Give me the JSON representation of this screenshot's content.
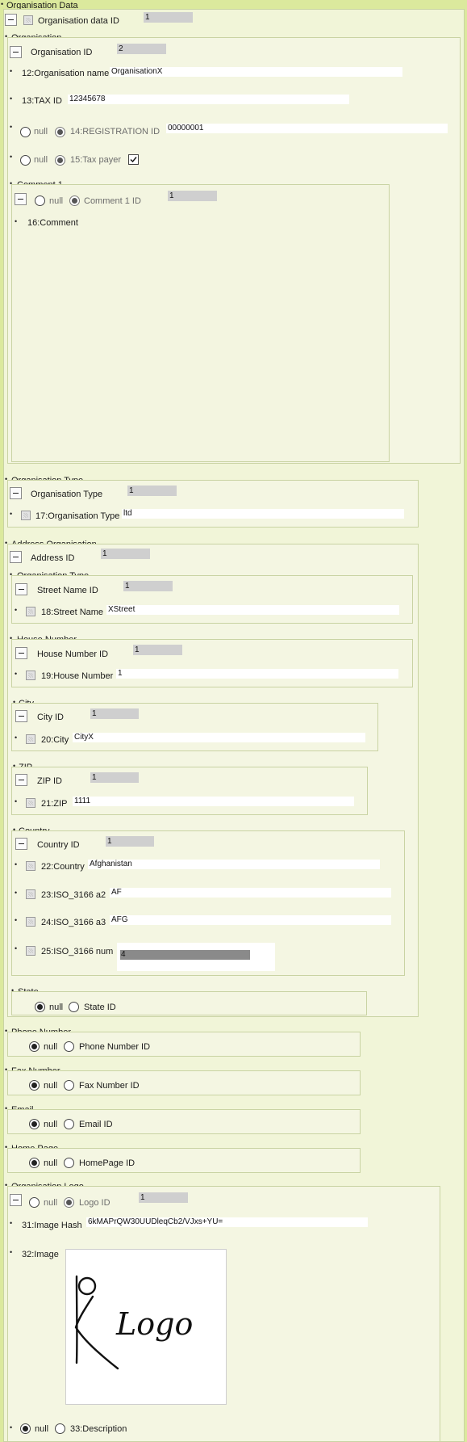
{
  "root": {
    "legend": "Organisation Data",
    "id_label": "Organisation data ID",
    "id_value": "1"
  },
  "organisation": {
    "legend": "Organisation",
    "id_label": "Organisation ID",
    "id_value": "2",
    "name_label": "12:Organisation name",
    "name_value": "OrganisationX",
    "tax_label": "13:TAX ID",
    "tax_value": "12345678",
    "null_label": "null",
    "reg_label": "14:REGISTRATION ID",
    "reg_value": "00000001",
    "taxpayer_label": "15:Tax payer",
    "taxpayer_checked": true
  },
  "comment": {
    "legend": "Comment 1",
    "null_label": "null",
    "id_label": "Comment 1 ID",
    "id_value": "1",
    "comment_label": "16:Comment"
  },
  "org_type": {
    "legend": "Organisation Type",
    "id_label": "Organisation Type",
    "id_value": "1",
    "type_label": "17:Organisation Type",
    "type_value": "ltd"
  },
  "address": {
    "legend": "Address Organisation",
    "id_label": "Address ID",
    "id_value": "1",
    "street": {
      "legend": "Organisation Type",
      "id_label": "Street Name ID",
      "id_value": "1",
      "name_label": "18:Street Name",
      "name_value": "XStreet"
    },
    "house": {
      "legend": "House Number",
      "id_label": "House Number ID",
      "id_value": "1",
      "num_label": "19:House Number",
      "num_value": "1"
    },
    "city": {
      "legend": "City",
      "id_label": "City ID",
      "id_value": "1",
      "city_label": "20:City",
      "city_value": "CityX"
    },
    "zip": {
      "legend": "ZIP",
      "id_label": "ZIP ID",
      "id_value": "1",
      "zip_label": "21:ZIP",
      "zip_value": "1111"
    },
    "country": {
      "legend": "Country",
      "id_label": "Country ID",
      "id_value": "1",
      "country_label": "22:Country",
      "country_value": "Afghanistan",
      "a2_label": "23:ISO_3166 a2",
      "a2_value": "AF",
      "a3_label": "24:ISO_3166 a3",
      "a3_value": "AFG",
      "num_label": "25:ISO_3166 num",
      "num_value": "4"
    },
    "state": {
      "legend": "State",
      "null_label": "null",
      "id_label": "State ID"
    }
  },
  "phone": {
    "legend": "Phone Number",
    "null_label": "null",
    "id_label": "Phone Number ID"
  },
  "fax": {
    "legend": "Fax Number",
    "null_label": "null",
    "id_label": "Fax Number ID"
  },
  "email": {
    "legend": "Email",
    "null_label": "null",
    "id_label": "Email ID"
  },
  "homepage": {
    "legend": "Home Page",
    "null_label": "null",
    "id_label": "HomePage ID"
  },
  "logo": {
    "legend": "Organisation Logo",
    "null_label": "null",
    "id_label": "Logo ID",
    "id_value": "1",
    "hash_label": "31:Image Hash",
    "hash_value": "6kMAPrQW30UUDleqCb2/VJxs+YU=",
    "image_label": "32:Image",
    "image_text": "Logo",
    "desc_null_label": "null",
    "desc_label": "33:Description"
  }
}
